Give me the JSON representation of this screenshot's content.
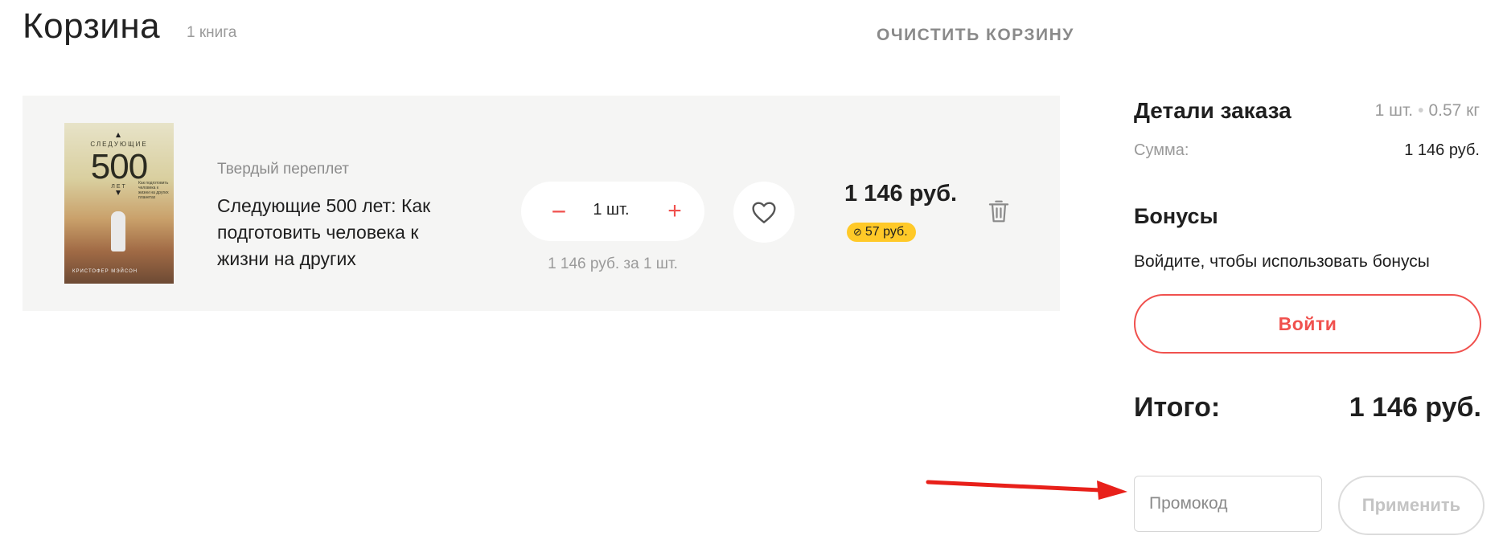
{
  "header": {
    "title": "Корзина",
    "count": "1 книга",
    "clear_label": "ОЧИСТИТЬ КОРЗИНУ"
  },
  "cart_item": {
    "binding": "Твердый переплет",
    "title": "Следующие 500 лет: Как подготовить человека к жизни на других",
    "cover": {
      "top_text": "СЛЕДУЮЩИЕ",
      "big_number": "500",
      "bottom_text": "ЛЕТ",
      "subtitle": "Как подготовить человека к жизни на других планетах",
      "author": "КРИСТОФЕР МЭЙСОН"
    },
    "quantity": {
      "minus_label": "−",
      "value": "1 шт.",
      "plus_label": "+"
    },
    "unit_price": "1 146 руб. за 1 шт.",
    "price": "1 146 руб.",
    "bonus": "57 руб.",
    "icons": {
      "favorite": "heart-icon",
      "delete": "trash-icon",
      "bonus": "bonus-coin-icon"
    }
  },
  "sidebar": {
    "order_details_title": "Детали заказа",
    "order_qty": "1 шт.",
    "order_weight": "0.57 кг",
    "sum_label": "Сумма:",
    "sum_value": "1 146 руб.",
    "bonus_title": "Бонусы",
    "bonus_text": "Войдите, чтобы использовать бонусы",
    "login_label": "Войти",
    "total_label": "Итого:",
    "total_value": "1 146 руб.",
    "promo_placeholder": "Промокод",
    "apply_label": "Применить"
  },
  "colors": {
    "accent": "#f0514e",
    "bonus_badge": "#ffc928",
    "card_bg": "#f5f5f4",
    "arrow": "#e8201a"
  }
}
